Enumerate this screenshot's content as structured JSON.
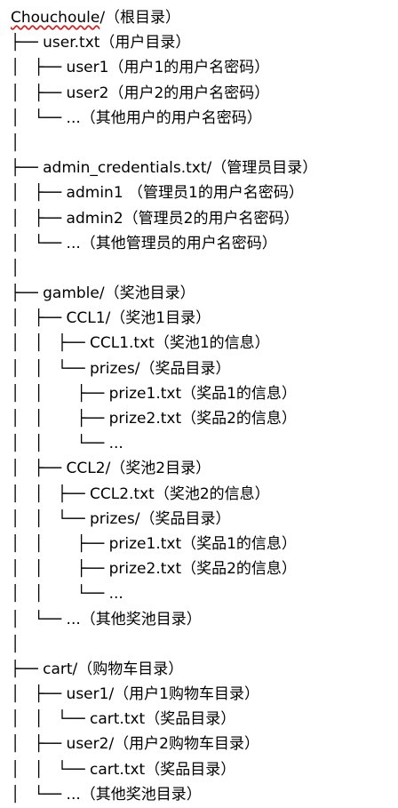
{
  "tree": {
    "root_name": "Chouchoule",
    "root_rest": "/（根目录）",
    "lines": [
      "├── user.txt（用户目录）",
      "│   ├── user1（用户1的用户名密码）",
      "│   ├── user2（用户2的用户名密码）",
      "│   └── ...（其他用户的用户名密码）",
      "│",
      "├── admin_credentials.txt/（管理员目录）",
      "│   ├── admin1 （管理员1的用户名密码）",
      "│   ├── admin2（管理员2的用户名密码）",
      "│   └── ...（其他管理员的用户名密码）",
      "│",
      "├── gamble/（奖池目录）",
      "│   ├── CCL1/（奖池1目录）",
      "│   │   ├── CCL1.txt（奖池1的信息）",
      "│   │   └── prizes/（奖品目录）",
      "│   │       ├── prize1.txt（奖品1的信息）",
      "│   │       ├── prize2.txt（奖品2的信息）",
      "│   │       └── ...",
      "│   ├── CCL2/（奖池2目录）",
      "│   │   ├── CCL2.txt（奖池2的信息）",
      "│   │   └── prizes/（奖品目录）",
      "│   │       ├── prize1.txt（奖品1的信息）",
      "│   │       ├── prize2.txt（奖品2的信息）",
      "│   │       └── ...",
      "│   └── ...（其他奖池目录）",
      "│",
      "├── cart/（购物车目录）",
      "│   ├── user1/（用户1购物车目录）",
      "│   │   └── cart.txt（奖品目录）",
      "│   ├── user2/（用户2购物车目录）",
      "│   │   └── cart.txt（奖品目录）",
      "│   └── ...（其他奖池目录）"
    ]
  }
}
